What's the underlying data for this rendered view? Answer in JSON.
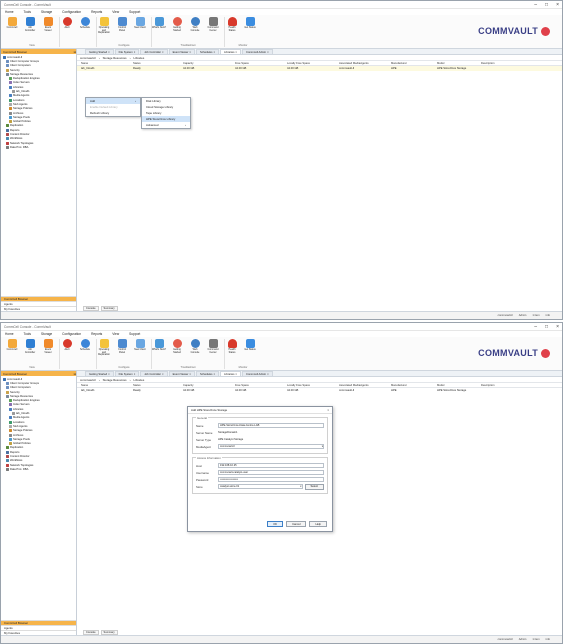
{
  "app": {
    "title": "CommCell Console - CommVault",
    "brand": "COMMVAULT",
    "menu": [
      "Home",
      "Tools",
      "Storage",
      "Configuration",
      "Reports",
      "View",
      "Support"
    ]
  },
  "ribbon": {
    "groups": [
      {
        "label": "View",
        "buttons": [
          "Commcell",
          "Job Controller",
          "Event Viewer"
        ]
      },
      {
        "label": "",
        "buttons": [
          "Alert",
          "Schedule"
        ]
      },
      {
        "label": "Configure",
        "buttons": [
          "Operating and Replication",
          "Control Panel",
          "New Client"
        ]
      },
      {
        "label": "Troubleshoot",
        "buttons": [
          "What's New?",
          "Getting Started",
          "Web Console",
          "Command Center"
        ]
      },
      {
        "label": "Monitor",
        "buttons": [
          "Health Status",
          "Get Status"
        ]
      }
    ]
  },
  "nav": {
    "header": "CommCell Browser",
    "tree": [
      "commvault-ll",
      "Client Computer Groups",
      "Client Computers",
      "Security",
      "Storage Resources",
      "Deduplication Engines",
      "Index Servers",
      "Libraries",
      "Media Agents",
      "Locations",
      "Stub Agents",
      "Storage Policies",
      "Archives",
      "Storage Pools",
      "Global Policies",
      "Replication",
      "Reports",
      "Content Director",
      "Workflows",
      "Network Topologies",
      "Data Prot. DBA"
    ],
    "bottom": [
      "CommCell Browser",
      "Agents",
      "My Favorites"
    ]
  },
  "tabs": [
    "Getting Started",
    "File System",
    "Job Controller",
    "Event Viewer",
    "Schedules",
    "Libraries",
    "Commcell Admin"
  ],
  "breadcrumb": [
    "commvault-ll",
    "Storage Resources",
    "Libraries"
  ],
  "grid": {
    "columns": [
      "Name",
      "Status",
      "Capacity",
      "Free Space",
      "Locally Free Space",
      "Associated MediaAgents",
      "Manufacturer",
      "Model",
      "Description"
    ],
    "rows": [
      [
        "lab_Cloud1",
        "Ready",
        "44.00 GB",
        "44.00 GB",
        "44.00 GB",
        "commvault-ll",
        "HPE",
        "HPE StoreOnce Storage",
        ""
      ]
    ]
  },
  "context_menu": {
    "items": [
      "Add",
      "Enable Default Library",
      "Refresh Library"
    ],
    "submenu": [
      "Disk Library",
      "Cloud Storage Library",
      "Tape Library",
      "HPE StoreOnce Library",
      "Advanced"
    ]
  },
  "dialog": {
    "title": "Add HPE StoreOnce Storage",
    "section_general": "General",
    "fields_general": [
      {
        "label": "Name",
        "value": "HPE-StoreOnce-Data-Centre-LAB"
      },
      {
        "label": "Server Name",
        "value": "StorageDomain1"
      },
      {
        "label": "Server Type",
        "value": "HPE Catalyst Storage"
      },
      {
        "label": "MediaAgent",
        "value": "commvault-ll"
      }
    ],
    "section_access": "Access Information",
    "fields_access": [
      {
        "label": "Host",
        "value": "192.168.10.25"
      },
      {
        "label": "Username",
        "value": "commvault-catalyst-user"
      },
      {
        "label": "Password",
        "value": "••••••••••••••••••••"
      },
      {
        "label": "Store",
        "value": "catalyst-store-01"
      }
    ],
    "select_button": "Select",
    "ok": "OK",
    "cancel": "Cancel",
    "help": "Help"
  },
  "status": {
    "items": [
      "commvault-ll",
      "Admin",
      "1 item",
      "info"
    ]
  },
  "bottom_tabs": [
    "Console",
    "Summary"
  ],
  "colors": {
    "accent": "#f6b44a",
    "brand": "#3a3f86",
    "row_highlight": "#fdfadf",
    "menu_highlight": "#cfe3f8"
  }
}
